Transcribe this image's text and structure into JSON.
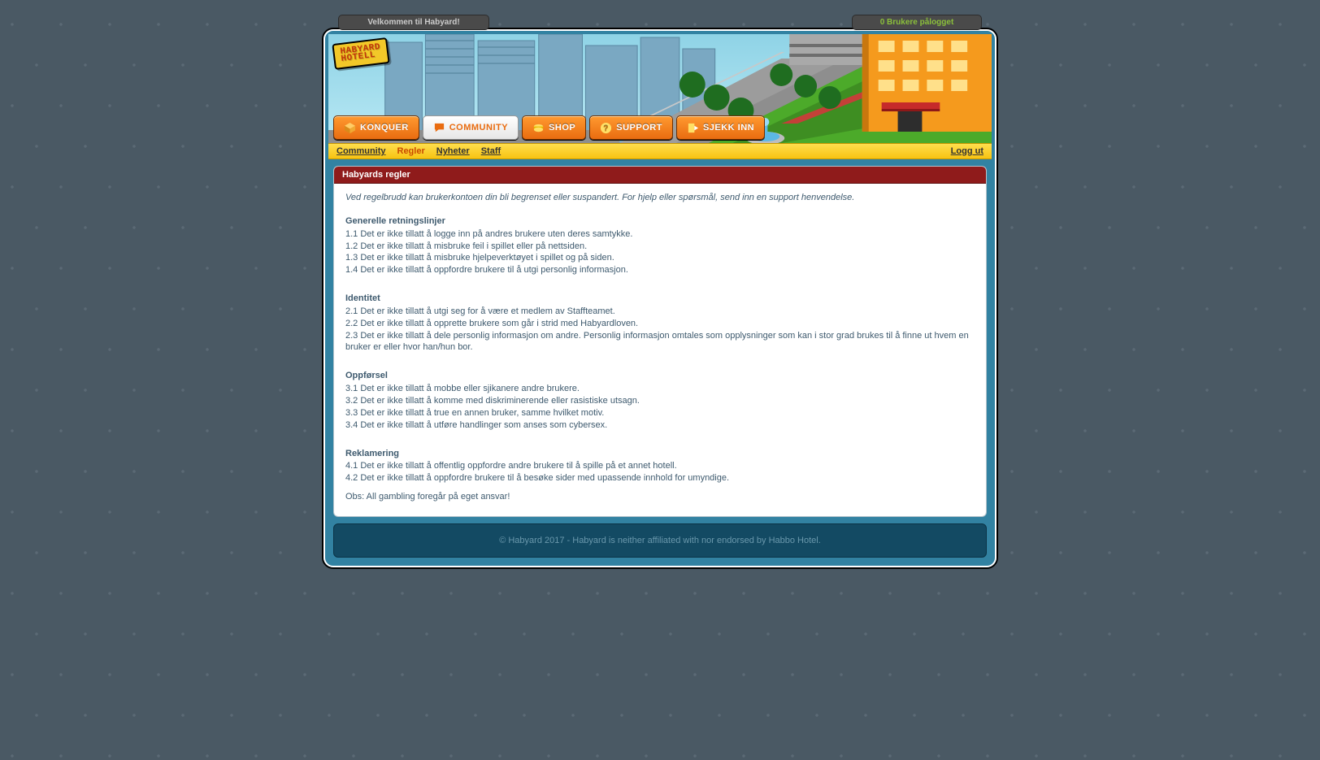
{
  "status": {
    "welcome": "Velkommen til Habyard!",
    "online": "0 Brukere pålogget"
  },
  "logo": {
    "line1": "HABYARD",
    "line2": "HOTELL"
  },
  "nav": {
    "items": [
      {
        "key": "konquer",
        "label": "KONQUER"
      },
      {
        "key": "community",
        "label": "COMMUNITY",
        "active": true
      },
      {
        "key": "shop",
        "label": "SHOP"
      },
      {
        "key": "support",
        "label": "SUPPORT"
      },
      {
        "key": "checkin",
        "label": "SJEKK INN"
      }
    ]
  },
  "subnav": {
    "items": [
      {
        "label": "Community"
      },
      {
        "label": "Regler",
        "current": true
      },
      {
        "label": "Nyheter"
      },
      {
        "label": "Staff"
      }
    ],
    "logout": "Logg ut"
  },
  "content": {
    "title": "Habyards regler",
    "intro": "Ved regelbrudd kan brukerkontoen din bli begrenset eller suspandert. For hjelp eller spørsmål, send inn en support henvendelse.",
    "sections": [
      {
        "title": "Generelle retningslinjer",
        "rules": [
          "1.1 Det er ikke tillatt å logge inn på andres brukere uten deres samtykke.",
          "1.2 Det er ikke tillatt å misbruke feil i spillet eller på nettsiden.",
          "1.3 Det er ikke tillatt å misbruke hjelpeverktøyet i spillet og på siden.",
          "1.4 Det er ikke tillatt å oppfordre brukere til å utgi personlig informasjon."
        ]
      },
      {
        "title": "Identitet",
        "rules": [
          "2.1 Det er ikke tillatt å utgi seg for å være et medlem av Staffteamet.",
          "2.2 Det er ikke tillatt å opprette brukere som går i strid med Habyardloven.",
          "2.3 Det er ikke tillatt å dele personlig informasjon om andre. Personlig informasjon omtales som opplysninger som kan i stor grad brukes til å finne ut hvem en bruker er eller hvor han/hun bor."
        ]
      },
      {
        "title": "Oppførsel",
        "rules": [
          "3.1 Det er ikke tillatt å mobbe eller sjikanere andre brukere.",
          "3.2 Det er ikke tillatt å komme med diskriminerende eller rasistiske utsagn.",
          "3.3 Det er ikke tillatt å true en annen bruker, samme hvilket motiv.",
          "3.4 Det er ikke tillatt å utføre handlinger som anses som cybersex."
        ]
      },
      {
        "title": "Reklamering",
        "rules": [
          "4.1 Det er ikke tillatt å offentlig oppfordre andre brukere til å spille på et annet hotell.",
          "4.2 Det er ikke tillatt å oppfordre brukere til å besøke sider med upassende innhold for umyndige."
        ]
      }
    ],
    "note": "Obs: All gambling foregår på eget ansvar!"
  },
  "footer": {
    "text": "© Habyard 2017 - Habyard is neither affiliated with nor endorsed by Habbo Hotel."
  }
}
